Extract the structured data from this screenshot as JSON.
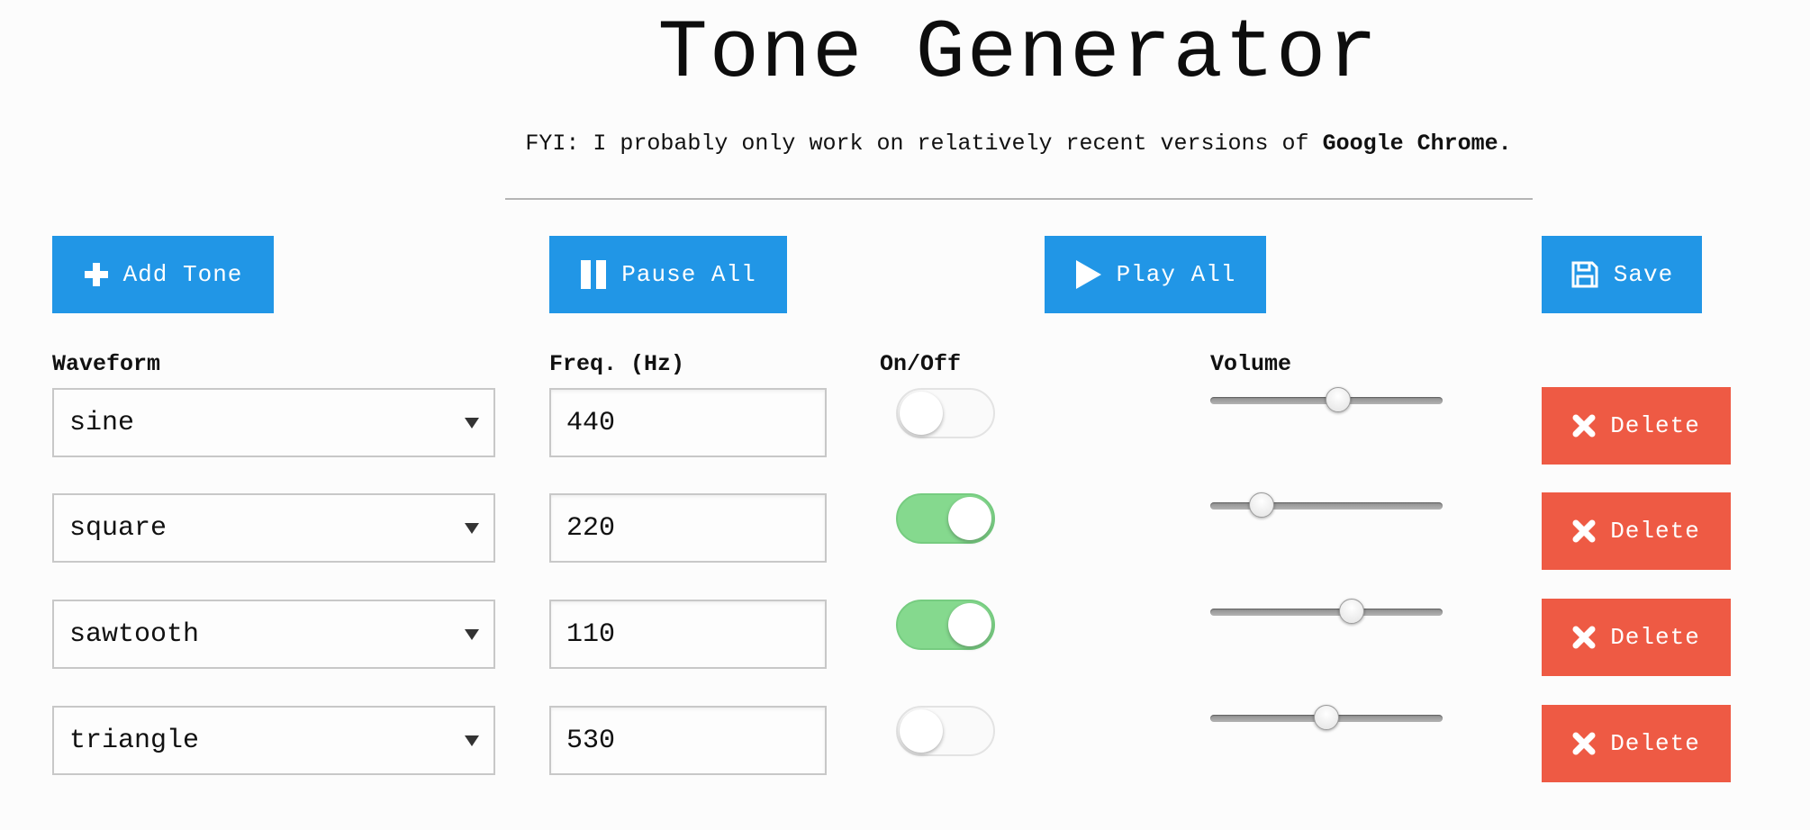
{
  "app": {
    "title": "Tone Generator",
    "notice_prefix": "FYI: I probably only work on relatively recent versions of",
    "notice_browser": "Google Chrome."
  },
  "toolbar": {
    "add_label": "Add Tone",
    "add_icon": "plus-icon",
    "pause_label": "Pause All",
    "pause_icon": "pause-icon",
    "play_label": "Play All",
    "play_icon": "play-icon",
    "save_label": "Save",
    "save_icon": "floppy-disk-icon"
  },
  "columns": {
    "waveform": "Waveform",
    "frequency": "Freq. (Hz)",
    "onoff": "On/Off",
    "volume": "Volume"
  },
  "tones": [
    {
      "waveform": "sine",
      "frequency": "440",
      "on": false,
      "volume": 0.55,
      "delete_label": "Delete"
    },
    {
      "waveform": "square",
      "frequency": "220",
      "on": true,
      "volume": 0.22,
      "delete_label": "Delete"
    },
    {
      "waveform": "sawtooth",
      "frequency": "110",
      "on": true,
      "volume": 0.61,
      "delete_label": "Delete"
    },
    {
      "waveform": "triangle",
      "frequency": "530",
      "on": false,
      "volume": 0.5,
      "delete_label": "Delete"
    }
  ],
  "colors": {
    "primary_button": "#2196e6",
    "delete_button": "#ee5a44",
    "toggle_on": "#85d98e"
  }
}
